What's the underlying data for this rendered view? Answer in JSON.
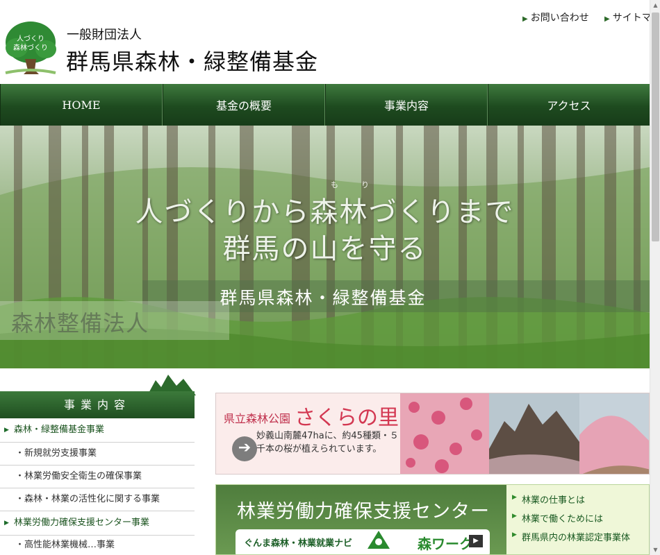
{
  "header": {
    "logo_text_line1": "人づくり",
    "logo_text_line2": "森林づくり",
    "org_type": "一般財団法人",
    "org_name": "群馬県森林・緑整備基金",
    "links": [
      {
        "label": "お問い合わせ"
      },
      {
        "label": "サイトマ"
      }
    ]
  },
  "nav": {
    "items": [
      {
        "label": "HOME"
      },
      {
        "label": "基金の概要"
      },
      {
        "label": "事業内容"
      },
      {
        "label": "アクセス"
      }
    ]
  },
  "hero": {
    "ruby_mo": "も",
    "ruby_ri": "り",
    "line1": "人づくりから森林づくりまで",
    "line2": "群馬の山を守る",
    "band_text": "群馬県森林・緑整備基金",
    "left_text": "森林整備法人"
  },
  "sidebar": {
    "heading": "事業内容",
    "items": [
      {
        "label": "森林・緑整備基金事業"
      },
      {
        "label": "・新規就労支援事業"
      },
      {
        "label": "・林業労働安全衛生の確保事業"
      },
      {
        "label": "・森林・林業の活性化に関する事業"
      },
      {
        "label": "林業労働力確保支援センター事業"
      },
      {
        "label": "・高性能林業機械…事業"
      }
    ]
  },
  "banner_sakura": {
    "title_small": "県立森林公園",
    "title_big": "さくらの里",
    "text": "妙義山南麓47haに、約45種類・５千本の桜が植えられています。"
  },
  "banner_center": {
    "title": "林業労働力確保支援センター",
    "navi_text": "ぐんま森林・林業就業ナビ",
    "work_text": "森ワーク",
    "links": [
      {
        "label": "林業の仕事とは"
      },
      {
        "label": "林業で働くためには"
      },
      {
        "label": "群馬県内の林業認定事業体"
      }
    ]
  },
  "colors": {
    "nav_green": "#1e4a1f",
    "sidebar_main_text": "#1d5521",
    "sakura_pink": "#d33852"
  }
}
